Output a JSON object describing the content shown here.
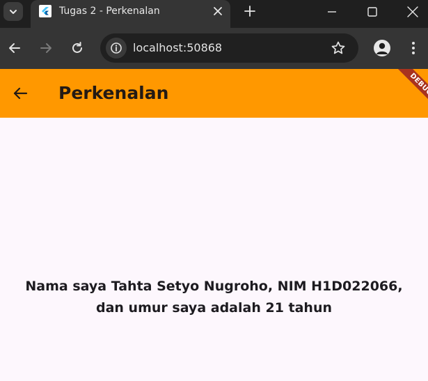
{
  "browser": {
    "tab": {
      "title": "Tugas 2 - Perkenalan"
    },
    "address_bar": {
      "url": "localhost:50868"
    },
    "icons": {
      "tab_search": "chevron-down-icon",
      "favicon": "flutter-icon",
      "tab_close": "close-icon",
      "new_tab": "plus-icon",
      "minimize": "minimize-icon",
      "maximize": "maximize-icon",
      "window_close": "close-icon",
      "back": "arrow-left-icon",
      "forward": "arrow-right-icon",
      "reload": "reload-icon",
      "site_info": "info-icon",
      "bookmark": "star-icon",
      "profile": "account-icon",
      "menu": "more-vertical-icon"
    },
    "colors": {
      "tabstrip": "#1f1f1f",
      "toolbar": "#353535",
      "omnibox": "#202020"
    }
  },
  "app": {
    "app_bar": {
      "title": "Perkenalan",
      "back_icon": "arrow-left-icon",
      "background": "#ff9800"
    },
    "debug_banner": {
      "label": "DEBUG",
      "color": "#a8331f"
    },
    "body": {
      "text_line1": "Nama saya Tahta Setyo Nugroho, NIM H1D022066,",
      "text_line2": "dan umur saya adalah 21 tahun",
      "background": "#fdf7fd"
    }
  }
}
